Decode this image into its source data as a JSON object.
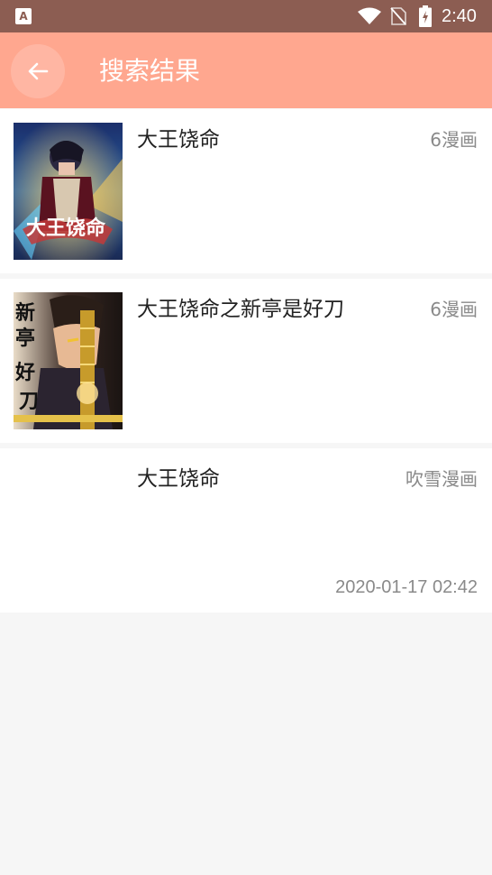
{
  "status_bar": {
    "app_icon_letter": "A",
    "time": "2:40",
    "icons": [
      "app-notification-icon",
      "wifi-icon",
      "no-sim-icon",
      "battery-charging-icon"
    ]
  },
  "header": {
    "back_icon": "arrow-left-icon",
    "title": "搜索结果",
    "background_color": "#ffa78f"
  },
  "results": [
    {
      "title": "大王饶命",
      "source": "6漫画",
      "has_cover": true,
      "cover_description": "漫画封面"
    },
    {
      "title": "大王饶命之新亭是好刀",
      "source": "6漫画",
      "has_cover": true,
      "cover_description": "漫画封面"
    },
    {
      "title": "大王饶命",
      "source": "吹雪漫画",
      "has_cover": false,
      "updated": "2020-01-17 02:42"
    }
  ]
}
